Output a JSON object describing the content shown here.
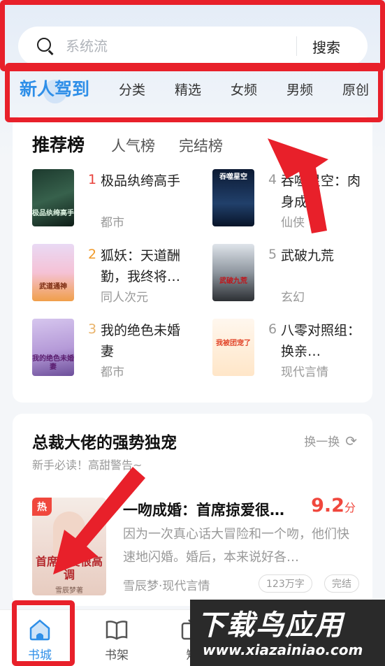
{
  "search": {
    "placeholder": "系统流",
    "button_label": "搜索"
  },
  "tabs": [
    "新人驾到",
    "分类",
    "精选",
    "女频",
    "男频",
    "原创"
  ],
  "ranking": {
    "tabs": [
      "推荐榜",
      "人气榜",
      "完结榜"
    ],
    "books": [
      {
        "rank": "1",
        "title": "极品纨绔高手",
        "genre": "都市",
        "cover_text": "极品纨绔高手",
        "rank_color": "#e8403a"
      },
      {
        "rank": "2",
        "title": "狐妖：天道酬勤，我终将…",
        "genre": "同人次元",
        "cover_text": "武道通神",
        "rank_color": "#f09a2a"
      },
      {
        "rank": "3",
        "title": "我的绝色未婚妻",
        "genre": "都市",
        "cover_text": "我的绝色未婚妻",
        "rank_color": "#e9b36a"
      },
      {
        "rank": "4",
        "title": "吞噬星空：肉身成圣",
        "genre": "仙侠",
        "cover_text": "吞噬星空",
        "rank_color": "#999999"
      },
      {
        "rank": "5",
        "title": "武破九荒",
        "genre": "玄幻",
        "cover_text": "武破九荒",
        "rank_color": "#999999"
      },
      {
        "rank": "6",
        "title": "八零对照组：换亲…",
        "genre": "现代言情",
        "cover_text": "我被团宠了",
        "rank_color": "#999999"
      }
    ]
  },
  "featured": {
    "section_title": "总裁大佬的强势独宠",
    "section_subtitle": "新手必读！高甜警告~",
    "refresh_label": "换一换",
    "hot_badge": "热",
    "cover_text": "首席掠爱很高调",
    "cover_author": "雪辰梦著",
    "title": "一吻成婚：首席掠爱很…",
    "score": "9.2",
    "score_unit": "分",
    "description": "因为一次真心话大冒险和一个吻，他们快速地闪婚。婚后，本来说好各…",
    "meta": "雪辰梦·现代言情",
    "word_count": "123万字",
    "status": "完结"
  },
  "bottom_nav": [
    {
      "label": "书城",
      "icon": "home-icon"
    },
    {
      "label": "书架",
      "icon": "book-icon"
    },
    {
      "label": "短",
      "icon": "tv-icon"
    }
  ],
  "watermark": {
    "main": "下载鸟应用",
    "url": "www.xiazainiao.com"
  },
  "colors": {
    "accent": "#2f8fe8",
    "annotation_red": "#e8202a",
    "score_red": "#f0473d"
  }
}
